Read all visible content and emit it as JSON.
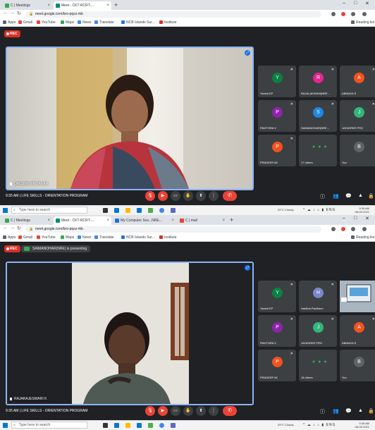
{
  "screens": [
    {
      "tabs": [
        {
          "label": "C | Meetings",
          "color": "#34a853"
        },
        {
          "label": "Meet - CKT-RCRT-...",
          "color": "#00897b",
          "active": true
        }
      ],
      "url": "meet.google.com/bro-pqsz-rkb",
      "bookmarks": [
        {
          "label": "Apps",
          "color": "#5f6368"
        },
        {
          "label": "Gmail",
          "color": "#ea4335"
        },
        {
          "label": "YouTube",
          "color": "#ea4335"
        },
        {
          "label": "Maps",
          "color": "#34a853"
        },
        {
          "label": "News",
          "color": "#4285f4"
        },
        {
          "label": "Translate",
          "color": "#4285f4"
        },
        {
          "label": "NCB Islands Sur...",
          "color": "#1a73e8"
        },
        {
          "label": "Institute",
          "color": "#d93025"
        }
      ],
      "reading_list": "Reading list",
      "rec_label": "REC",
      "presenting": "",
      "main_name": "LAKSHMI PRIYANKA",
      "tiles": [
        {
          "initial": "Y",
          "name": "Yamini EP",
          "color": "#0b8043"
        },
        {
          "initial": "R",
          "name": "RAJALAKSHMI(NRE...",
          "color": "#e52592"
        },
        {
          "initial": "A",
          "name": "ABINAYA S",
          "color": "#f4511e"
        },
        {
          "initial": "P",
          "name": "PAVITHRA V",
          "color": "#8e24aa"
        },
        {
          "initial": "S",
          "name": "SAIMANOHAR(NRE...",
          "color": "#1e88e5"
        },
        {
          "initial": "J",
          "name": "JAYASREE PRO",
          "color": "#33b679"
        },
        {
          "initial": "P",
          "name": "PRADEEP MI",
          "color": "#f4511e"
        },
        {
          "initial": "",
          "name": "17 others",
          "color": "#5f6368",
          "dots": true
        },
        {
          "initial": "B",
          "name": "You",
          "color": "#5f6368"
        }
      ],
      "meeting_info": "9:35 AM  |  LIFE SKILLS - ORIENTATION PROGRAM",
      "taskbar": {
        "search": "Type here to search",
        "weather": "29°C Cloudy",
        "time": "9:35 AM",
        "date": "08-09-2021"
      }
    },
    {
      "tabs": [
        {
          "label": "C | Meetings",
          "color": "#34a853"
        },
        {
          "label": "Meet - CKT-RCRT-...",
          "color": "#00897b",
          "active": true
        },
        {
          "label": "My Computer Ses...NRE...",
          "color": "#1a73e8"
        },
        {
          "label": "C | mail",
          "color": "#ea4335"
        }
      ],
      "url": "meet.google.com/bro-pqsz-rkb",
      "bookmarks": [
        {
          "label": "Apps",
          "color": "#5f6368"
        },
        {
          "label": "Gmail",
          "color": "#ea4335"
        },
        {
          "label": "YouTube",
          "color": "#ea4335"
        },
        {
          "label": "Maps",
          "color": "#34a853"
        },
        {
          "label": "News",
          "color": "#4285f4"
        },
        {
          "label": "Translate",
          "color": "#4285f4"
        },
        {
          "label": "NCB Islands Sur...",
          "color": "#1a73e8"
        },
        {
          "label": "Institute",
          "color": "#d93025"
        }
      ],
      "reading_list": "Reading list",
      "rec_label": "REC",
      "presenting": "SAIMANOHAR(NRE) is presenting",
      "main_name": "RAJARAJESWARI K",
      "tiles": [
        {
          "initial": "Y",
          "name": "Yamini EP",
          "color": "#0b8043"
        },
        {
          "initial": "H",
          "name": "Harikha Pavitmon",
          "color": "#7986cb"
        },
        {
          "initial": "",
          "name": "",
          "color": "#5f6368",
          "screen": true
        },
        {
          "initial": "P",
          "name": "PAVITHRA V",
          "color": "#8e24aa"
        },
        {
          "initial": "J",
          "name": "JAYASREE PRO",
          "color": "#33b679"
        },
        {
          "initial": "A",
          "name": "ABINAYA S",
          "color": "#f4511e"
        },
        {
          "initial": "P",
          "name": "PRADEEP MI",
          "color": "#f4511e"
        },
        {
          "initial": "",
          "name": "18 others",
          "color": "#5f6368",
          "dots": true
        },
        {
          "initial": "B",
          "name": "You",
          "color": "#5f6368"
        }
      ],
      "meeting_info": "9:35 AM  |  LIFE SKILLS - ORIENTATION PROGRAM",
      "taskbar": {
        "search": "Type here to search",
        "weather": "29°C Cloudy",
        "time": "9:35 AM",
        "date": "08-09-2021"
      }
    }
  ]
}
